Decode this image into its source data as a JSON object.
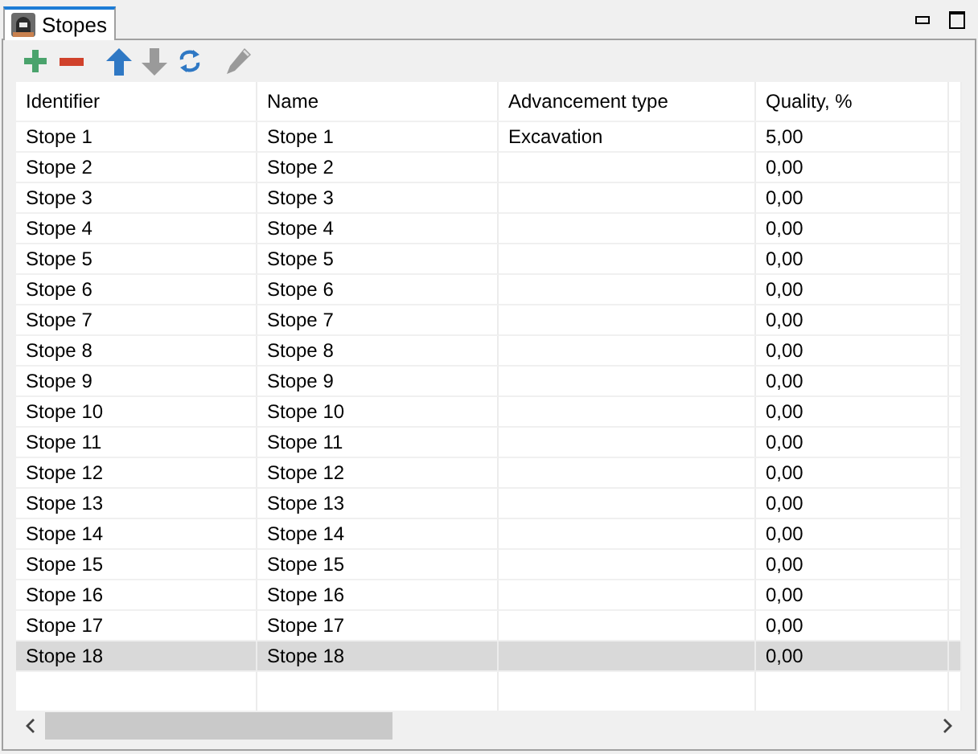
{
  "tab": {
    "title": "Stopes",
    "selected": true
  },
  "toolbar": [
    {
      "kind": "add",
      "disabled": false
    },
    {
      "kind": "remove",
      "disabled": false
    },
    {
      "kind": "up",
      "disabled": false
    },
    {
      "kind": "down",
      "disabled": true
    },
    {
      "kind": "refresh",
      "disabled": false
    },
    {
      "kind": "edit",
      "disabled": true
    }
  ],
  "table": {
    "columns": [
      "Identifier",
      "Name",
      "Advancement type",
      "Quality, %"
    ],
    "rows": [
      {
        "cells": [
          "Stope 1",
          "Stope 1",
          "Excavation",
          "5,00"
        ],
        "selected": false
      },
      {
        "cells": [
          "Stope 2",
          "Stope 2",
          "",
          "0,00"
        ],
        "selected": false
      },
      {
        "cells": [
          "Stope 3",
          "Stope 3",
          "",
          "0,00"
        ],
        "selected": false
      },
      {
        "cells": [
          "Stope 4",
          "Stope 4",
          "",
          "0,00"
        ],
        "selected": false
      },
      {
        "cells": [
          "Stope 5",
          "Stope 5",
          "",
          "0,00"
        ],
        "selected": false
      },
      {
        "cells": [
          "Stope 6",
          "Stope 6",
          "",
          "0,00"
        ],
        "selected": false
      },
      {
        "cells": [
          "Stope 7",
          "Stope 7",
          "",
          "0,00"
        ],
        "selected": false
      },
      {
        "cells": [
          "Stope 8",
          "Stope 8",
          "",
          "0,00"
        ],
        "selected": false
      },
      {
        "cells": [
          "Stope 9",
          "Stope 9",
          "",
          "0,00"
        ],
        "selected": false
      },
      {
        "cells": [
          "Stope 10",
          "Stope 10",
          "",
          "0,00"
        ],
        "selected": false
      },
      {
        "cells": [
          "Stope 11",
          "Stope 11",
          "",
          "0,00"
        ],
        "selected": false
      },
      {
        "cells": [
          "Stope 12",
          "Stope 12",
          "",
          "0,00"
        ],
        "selected": false
      },
      {
        "cells": [
          "Stope 13",
          "Stope 13",
          "",
          "0,00"
        ],
        "selected": false
      },
      {
        "cells": [
          "Stope 14",
          "Stope 14",
          "",
          "0,00"
        ],
        "selected": false
      },
      {
        "cells": [
          "Stope 15",
          "Stope 15",
          "",
          "0,00"
        ],
        "selected": false
      },
      {
        "cells": [
          "Stope 16",
          "Stope 16",
          "",
          "0,00"
        ],
        "selected": false
      },
      {
        "cells": [
          "Stope 17",
          "Stope 17",
          "",
          "0,00"
        ],
        "selected": false
      },
      {
        "cells": [
          "Stope 18",
          "Stope 18",
          "",
          "0,00"
        ],
        "selected": true
      }
    ]
  }
}
